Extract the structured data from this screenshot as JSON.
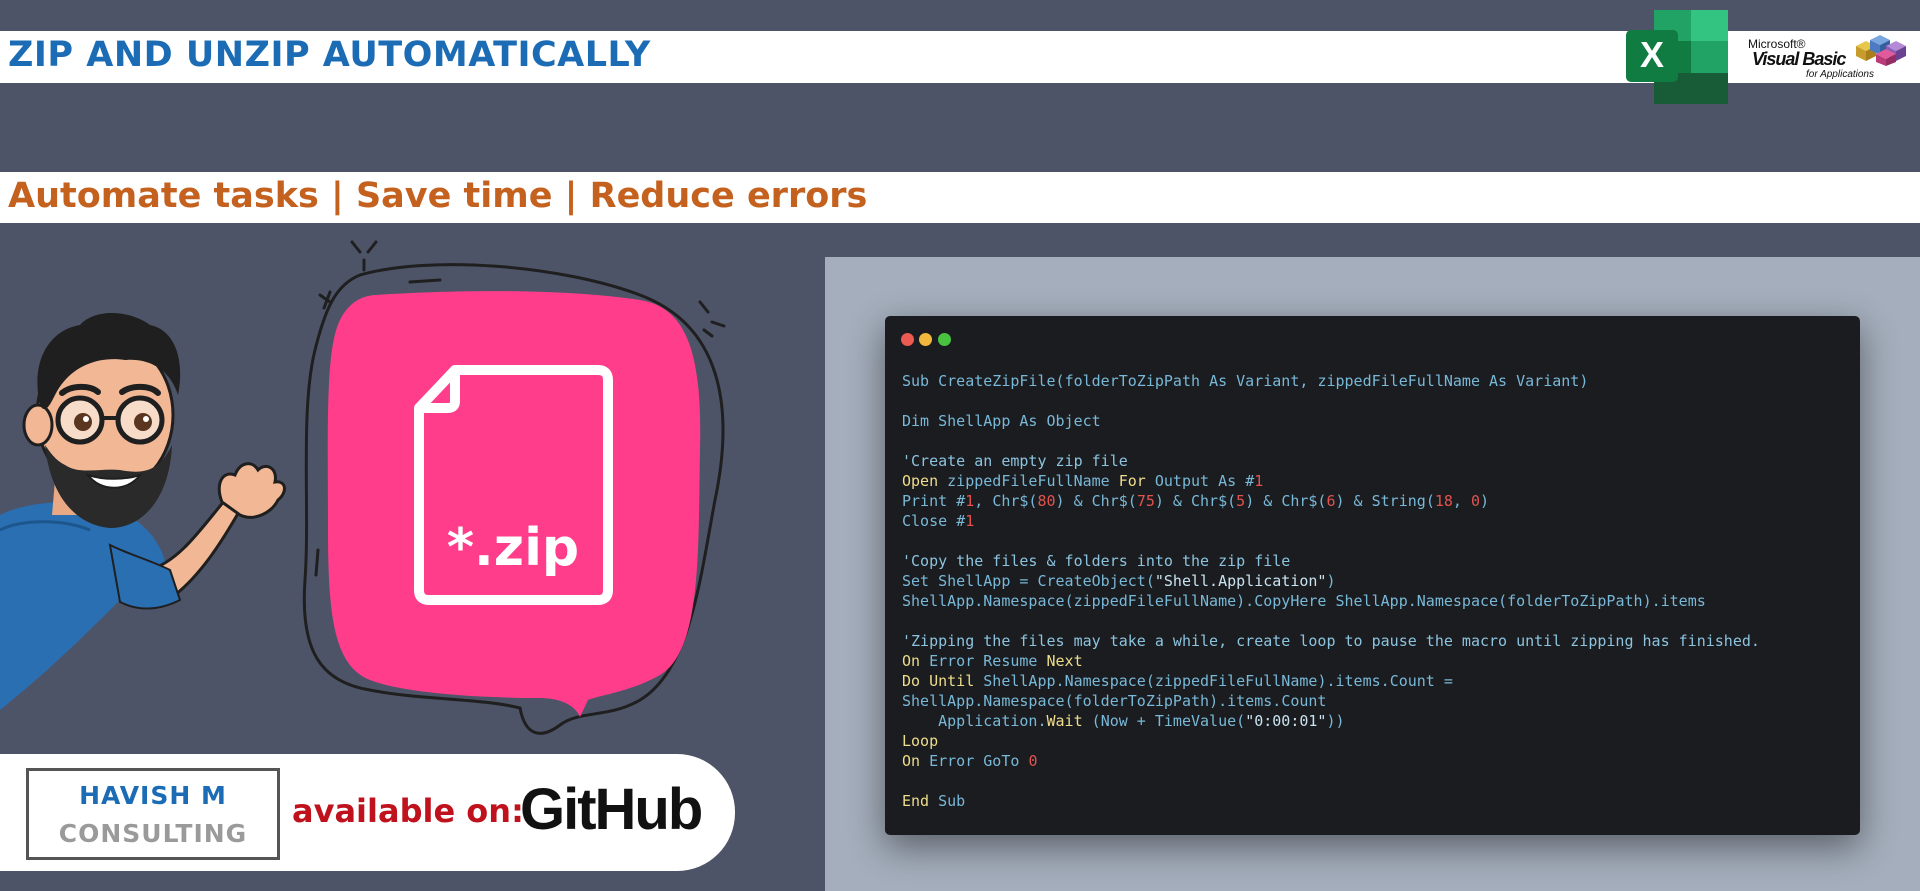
{
  "banner": {
    "title": "ZIP AND UNZIP AUTOMATICALLY",
    "tagline": "Automate tasks | Save time | Reduce errors",
    "title_color": "#1b6cb4",
    "tagline_color": "#c4611e"
  },
  "logos": {
    "excel_icon": "excel-logo",
    "excel_letter": "X",
    "vba_microsoft": "Microsoft®",
    "vba_name": "Visual Basic",
    "vba_for": "for Applications"
  },
  "illustration": {
    "icon": "zip-file-icon",
    "file_label": "*.zip",
    "bubble_color": "#ff3d8b"
  },
  "code_window": {
    "traffic_lights": [
      "close",
      "minimize",
      "maximize"
    ],
    "lines": [
      "Sub CreateZipFile(folderToZipPath As Variant, zippedFileFullName As Variant)",
      "",
      "Dim ShellApp As Object",
      "",
      "'Create an empty zip file",
      "Open zippedFileFullName For Output As #1",
      "Print #1, Chr$(80) & Chr$(75) & Chr$(5) & Chr$(6) & String(18, 0)",
      "Close #1",
      "",
      "'Copy the files & folders into the zip file",
      "Set ShellApp = CreateObject(\"Shell.Application\")",
      "ShellApp.Namespace(zippedFileFullName).CopyHere ShellApp.Namespace(folderToZipPath).items",
      "",
      "'Zipping the files may take a while, create loop to pause the macro until zipping has finished.",
      "On Error Resume Next",
      "Do Until ShellApp.Namespace(zippedFileFullName).items.Count =",
      "ShellApp.Namespace(folderToZipPath).items.Count",
      "    Application.Wait (Now + TimeValue(\"0:00:01\"))",
      "Loop",
      "On Error GoTo 0",
      "",
      "End Sub"
    ]
  },
  "brand": {
    "name": "HAVISH M",
    "subtitle": "CONSULTING",
    "available": "available on:",
    "platform": "GitHub"
  }
}
